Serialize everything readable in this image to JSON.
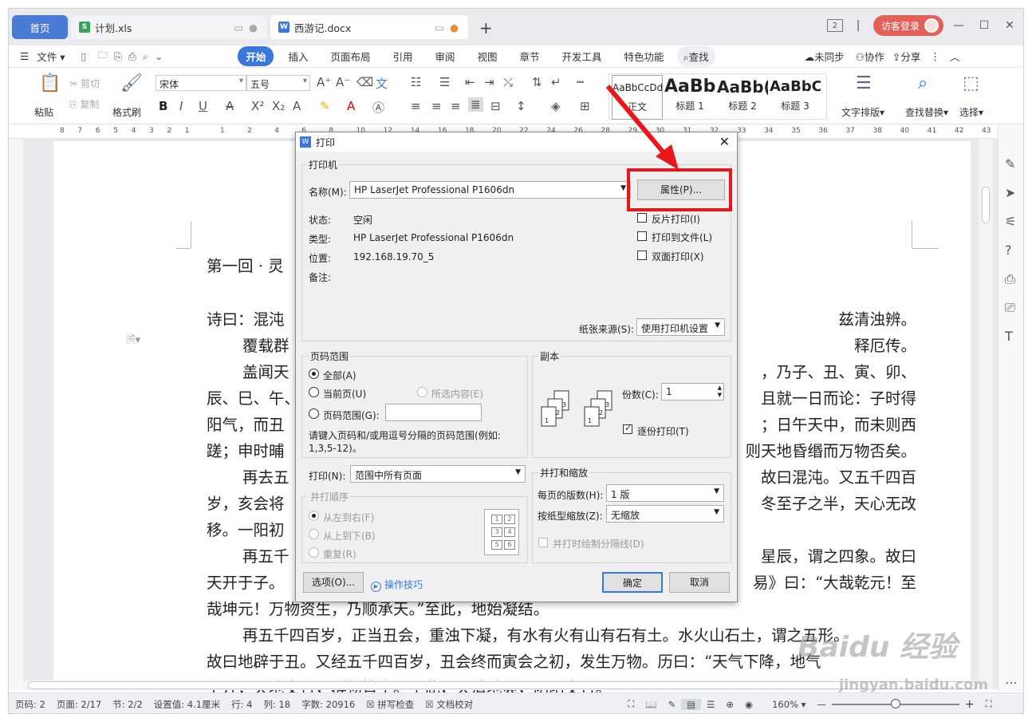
{
  "tabs": {
    "home": "首页",
    "xls": "计划.xls",
    "doc": "西游记.docx"
  },
  "window": {
    "guest_label": "访客登录",
    "badge": "2"
  },
  "menu": {
    "file": "文件",
    "items": [
      "开始",
      "插入",
      "页面布局",
      "引用",
      "审阅",
      "视图",
      "章节",
      "开发工具",
      "特色功能"
    ],
    "search": "查找",
    "sync": "未同步",
    "collab": "协作",
    "share": "分享"
  },
  "ribbon": {
    "paste": "粘贴",
    "cut": "剪切",
    "copy": "复制",
    "format_painter": "格式刷",
    "font_name": "宋体",
    "font_size": "五号",
    "styles": [
      {
        "sample": "AaBbCcDd",
        "name": "正文"
      },
      {
        "sample": "AaBb",
        "name": "标题 1"
      },
      {
        "sample": "AaBb(",
        "name": "标题 2"
      },
      {
        "sample": "AaBbC(",
        "name": "标题 3"
      }
    ],
    "text_layout": "文字排版",
    "find_replace": "查找替换",
    "select": "选择"
  },
  "ruler": {
    "left_nums": [
      "8",
      "7",
      "6",
      "5",
      "4",
      "3",
      "2",
      "1"
    ],
    "right_nums": [
      "1",
      "2",
      "4",
      "6",
      "8",
      "10",
      "12",
      "14",
      "16",
      "18",
      "20",
      "22",
      "24",
      "26",
      "28",
      "29",
      "30",
      "31",
      "32",
      "33",
      "34",
      "35",
      "36",
      "37",
      "38",
      "40",
      "41",
      "42",
      "43"
    ]
  },
  "document": {
    "lines": [
      "第一回 · 灵",
      "诗曰：混沌",
      "覆载群",
      "盖闻天",
      "辰、巳、午、",
      "阳气，而丑",
      "蹉；申时晡",
      "再去五",
      "岁，亥会将",
      "移。一阳初",
      "再五千",
      "天开于子。",
      "哉坤元！万物资生，乃顺承天。”至此，地始凝结。",
      "再五千四百岁，正当丑会，重浊下凝，有水有火有山有石有土。水火山石土，谓之五形。",
      "故曰地辟于丑。又经五千四百岁，丑会终而寅会之初，发生万物。历曰：“天气下降，地气",
      "上升；天地交合，群物皆生。”至此，天清地爽，阴阳交合。"
    ],
    "right_fragments": [
      "兹清浊辨。",
      "释厄传。",
      "，乃子、丑、寅、卯、",
      "且就一日而论：子时得",
      "；日午天中，而未则西",
      "则天地昏缗而万物否矣。",
      "故曰混沌。又五千四百",
      "冬至子之半，天心无改",
      "星辰，谓之四象。故曰",
      "易》曰：“大哉乾元！至"
    ]
  },
  "dialog": {
    "title": "打印",
    "printer_group": "打印机",
    "name_label": "名称(M):",
    "printer_name": "HP LaserJet Professional P1606dn",
    "properties_btn": "属性(P)...",
    "status_label": "状态:",
    "status_value": "空闲",
    "type_label": "类型:",
    "type_value": "HP LaserJet Professional P1606dn",
    "location_label": "位置:",
    "location_value": "192.168.19.70_5",
    "comment_label": "备注:",
    "reverse_print": "反片打印(I)",
    "print_to_file": "打印到文件(L)",
    "duplex": "双面打印(X)",
    "paper_source_label": "纸张来源(S):",
    "paper_source_value": "使用打印机设置",
    "range_group": "页码范围",
    "all": "全部(A)",
    "current": "当前页(U)",
    "selection": "所选内容(E)",
    "pages": "页码范围(G):",
    "range_hint": "请键入页码和/或用逗号分隔的页码范围(例如:",
    "range_hint2": "1,3,5-12)。",
    "copies_group": "副本",
    "copies_label": "份数(C):",
    "copies_value": "1",
    "collate": "逐份打印(T)",
    "print_label": "打印(N):",
    "print_value": "范围中所有页面",
    "order_group": "并打顺序",
    "order_lr": "从左到右(F)",
    "order_tb": "从上到下(B)",
    "order_repeat": "重复(R)",
    "order_nums": [
      "1",
      "2",
      "3",
      "4",
      "5",
      "6"
    ],
    "scale_group": "并打和缩放",
    "per_page_label": "每页的版数(H):",
    "per_page_value": "1 版",
    "scale_label": "按纸型缩放(Z):",
    "scale_value": "无缩放",
    "draw_lines": "并打时绘制分隔线(D)",
    "options_btn": "选项(O)...",
    "tips": "操作技巧",
    "ok": "确定",
    "cancel": "取消"
  },
  "statusbar": {
    "page_no": "页码: 2",
    "pages": "页面: 2/17",
    "section": "节: 2/2",
    "setting": "设置值: 4.1厘米",
    "row": "行: 4",
    "col": "列: 18",
    "words": "字数: 20916",
    "spell": "拼写检查",
    "proof": "文档校对",
    "zoom": "160%"
  },
  "watermark": {
    "main": "Baidu 经验",
    "sub": "jingyan.baidu.com"
  },
  "colors": {
    "accent": "#3b77d8",
    "highlight": "#e8171b",
    "guest": "#e2605a"
  }
}
